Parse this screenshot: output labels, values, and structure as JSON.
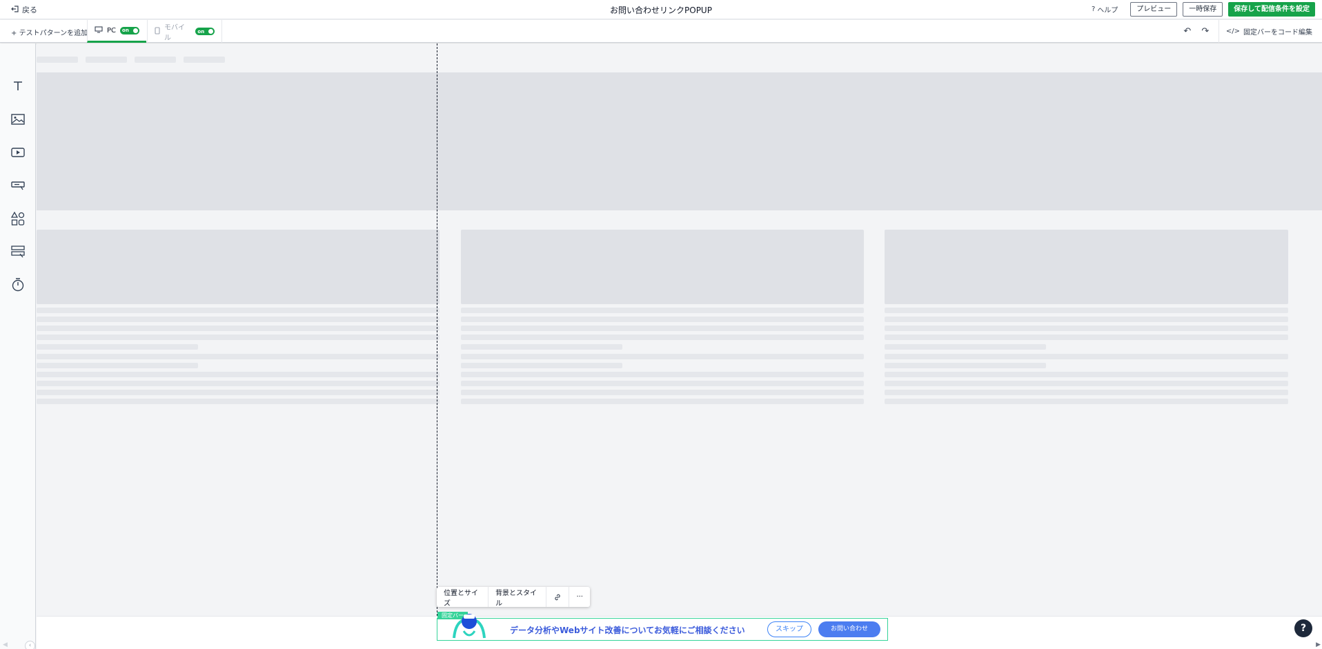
{
  "header": {
    "back_label": "戻る",
    "title": "お問い合わせリンクPOPUP",
    "help_label": "ヘルプ",
    "preview_label": "プレビュー",
    "temp_save_label": "一時保存",
    "save_label": "保存して配信条件を設定"
  },
  "toolbar": {
    "add_pattern_label": "テストパターンを追加",
    "tabs": [
      {
        "label": "PC",
        "toggle": "on"
      },
      {
        "label": "モバイル",
        "toggle": "on"
      }
    ],
    "code_edit_label": "固定バーをコード編集"
  },
  "rail": {
    "tools": [
      "text-tool-icon",
      "image-tool-icon",
      "video-tool-icon",
      "button-tool-icon",
      "shapes-tool-icon",
      "form-tool-icon",
      "timer-tool-icon"
    ]
  },
  "element_toolbar": {
    "position_size_label": "位置とサイズ",
    "background_style_label": "背景とスタイル"
  },
  "fixed_bar": {
    "tag_label": "固定バー",
    "message": "データ分析やWebサイト改善についてお気軽にご相談ください",
    "skip_label": "スキップ",
    "contact_label": "お問い合わせ"
  },
  "colors": {
    "accent_green": "#16a34a",
    "bar_border": "#34d399",
    "bar_text": "#3b5bdb",
    "contact_button": "#4c7df0"
  }
}
